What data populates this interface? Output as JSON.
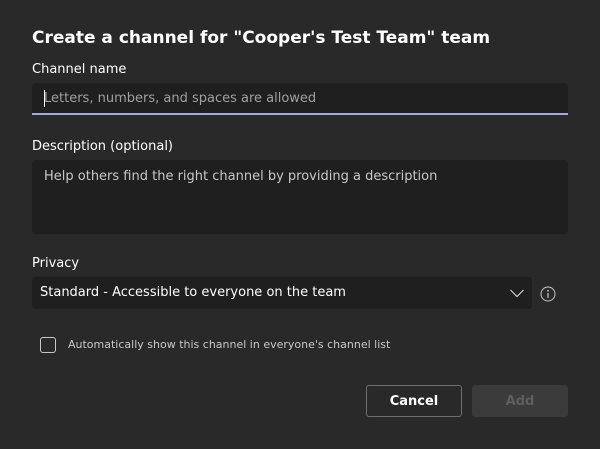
{
  "dialog": {
    "title": "Create a channel for \"Cooper's Test Team\" team"
  },
  "channel_name": {
    "label": "Channel name",
    "value": "",
    "placeholder": "Letters, numbers, and spaces are allowed"
  },
  "description": {
    "label": "Description (optional)",
    "value": "",
    "placeholder": "Help others find the right channel by providing a description"
  },
  "privacy": {
    "label": "Privacy",
    "selected": "Standard - Accessible to everyone on the team",
    "chevron_icon": "chevron-down-icon",
    "info_icon": "info-icon"
  },
  "auto_show": {
    "label": "Automatically show this channel in everyone's channel list",
    "checked": false
  },
  "buttons": {
    "cancel": "Cancel",
    "add": "Add"
  },
  "colors": {
    "background": "#292929",
    "field": "#1f1f1f",
    "focus_underline": "#a6a7dc",
    "disabled_button": "#3b3b3b"
  }
}
